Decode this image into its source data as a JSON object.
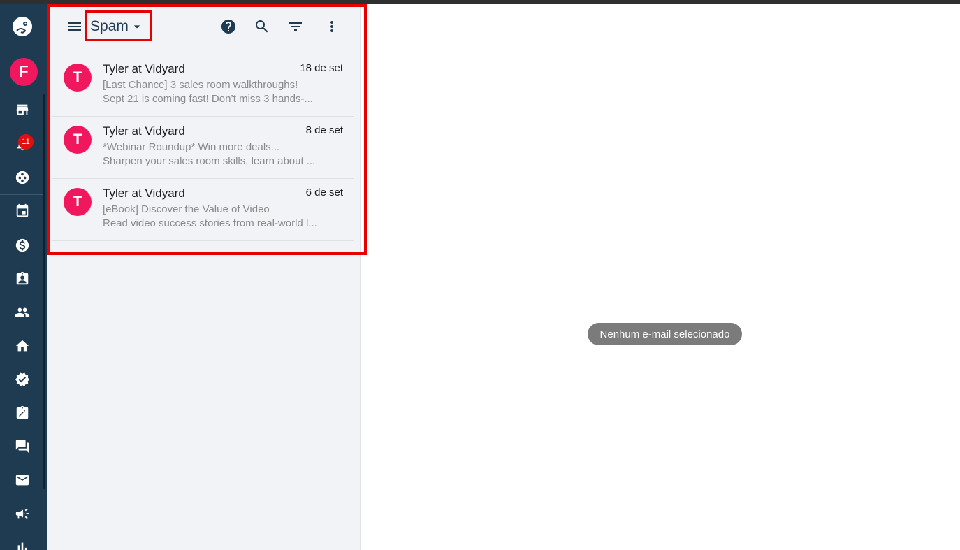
{
  "sidebar": {
    "user_initial": "F",
    "notification_count": "11",
    "icons": [
      "shopping-app-icon",
      "store-icon",
      "bell-icon",
      "team-icon",
      "calendar-icon",
      "dollar-icon",
      "contact-card-icon",
      "people-icon",
      "home-icon",
      "verified-icon",
      "edit-note-icon",
      "chat-icon",
      "mail-icon",
      "megaphone-icon",
      "chart-icon"
    ]
  },
  "toolbar": {
    "folder": "Spam",
    "icons": [
      "menu-icon",
      "help-icon",
      "search-icon",
      "filter-icon",
      "more-vert-icon"
    ]
  },
  "mails": [
    {
      "initial": "T",
      "sender": "Tyler at Vidyard",
      "date": "18 de set",
      "subject": "[Last Chance] 3 sales room walkthroughs!",
      "preview": "Sept 21 is coming fast! Don’t miss 3 hands-..."
    },
    {
      "initial": "T",
      "sender": "Tyler at Vidyard",
      "date": "8 de set",
      "subject": "*Webinar Roundup* Win more deals...",
      "preview": "Sharpen your sales room skills, learn about ..."
    },
    {
      "initial": "T",
      "sender": "Tyler at Vidyard",
      "date": "6 de set",
      "subject": "[eBook] Discover the Value of Video",
      "preview": "Read video success stories from real-world l..."
    }
  ],
  "reading_pane": {
    "empty_text": "Nenhum e-mail selecionado"
  },
  "colors": {
    "rail": "#1f3b52",
    "panel": "#f1f3f7",
    "accent": "#f0175f",
    "highlight": "#e60000",
    "badge": "#e01010"
  }
}
